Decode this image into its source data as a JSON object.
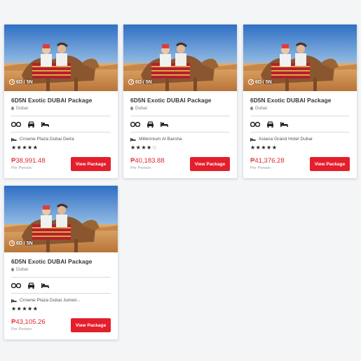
{
  "packages": [
    {
      "duration": "6D / 5N",
      "title": "6D5N Exotic DUBAI Package",
      "location": "Dubai",
      "hotel": "Crowne Plaza Dubai Deira",
      "stars": "★★★★★",
      "stars_empty": "",
      "rating": 5,
      "price": "₱38,991.48",
      "per_person": "Per Person",
      "button": "View Package"
    },
    {
      "duration": "6D / 5N",
      "title": "6D5N Exotic DUBAI Package",
      "location": "Dubai",
      "hotel": "Millennium Al Barsha",
      "stars": "★★★★",
      "stars_empty": "☆",
      "rating": 4,
      "price": "₱40,183.88",
      "per_person": "Per Person",
      "button": "View Package"
    },
    {
      "duration": "6D / 5N",
      "title": "6D5N Exotic DUBAI Package",
      "location": "Dubai",
      "hotel": "Asiana Grand Hotel Dubai",
      "stars": "★★★★★",
      "stars_empty": "",
      "rating": 5,
      "price": "₱41,376.28",
      "per_person": "Per Person",
      "button": "View Package"
    },
    {
      "duration": "6D / 5N",
      "title": "6D5N Exotic DUBAI Package",
      "location": "Dubai",
      "hotel": "Crowne Plaza Dubai Jumeir...",
      "stars": "★★★★★",
      "stars_empty": "",
      "rating": 5,
      "price": "₱43,105.26",
      "per_person": "Per Person",
      "button": "View Package"
    }
  ],
  "amenity_icons": [
    "binoculars-icon",
    "car-icon",
    "bed-icon"
  ],
  "colors": {
    "accent": "#e41e2b",
    "price": "#e0252b",
    "sky": "#3a78c8",
    "sand": "#d99a55"
  }
}
